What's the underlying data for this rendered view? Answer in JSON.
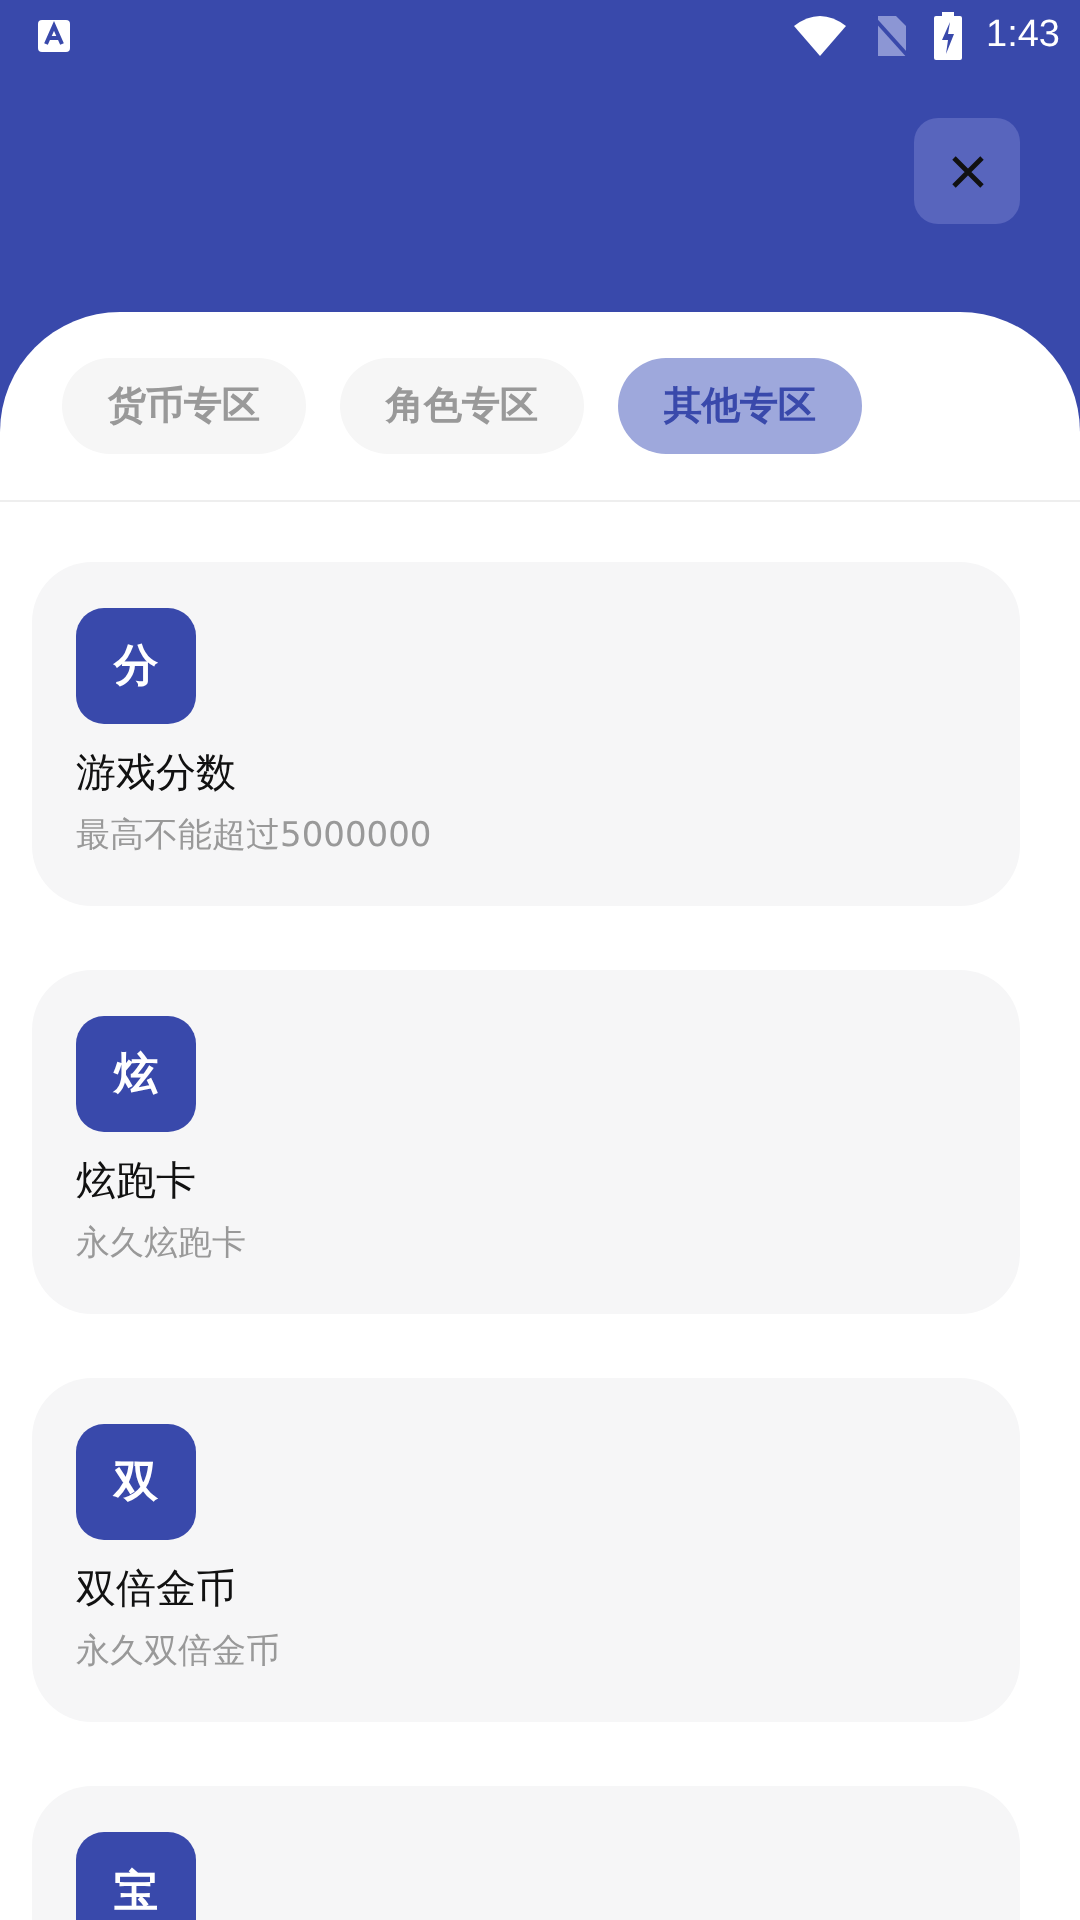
{
  "status_bar": {
    "time": "1:43"
  },
  "tabs": [
    {
      "label": "货币专区",
      "selected": false
    },
    {
      "label": "角色专区",
      "selected": false
    },
    {
      "label": "其他专区",
      "selected": true
    }
  ],
  "items": [
    {
      "icon_text": "分",
      "title": "游戏分数",
      "subtitle": "最高不能超过5000000"
    },
    {
      "icon_text": "炫",
      "title": "炫跑卡",
      "subtitle": "永久炫跑卡"
    },
    {
      "icon_text": "双",
      "title": "双倍金币",
      "subtitle": "永久双倍金币"
    },
    {
      "icon_text": "宝"
    }
  ]
}
